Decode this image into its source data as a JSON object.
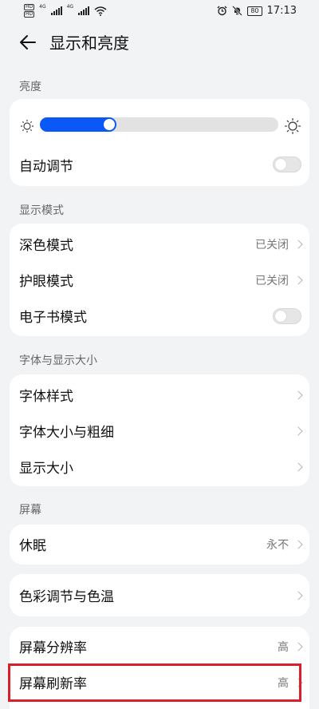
{
  "status": {
    "sim1": "HD",
    "sim2": "HD",
    "net1": "4G",
    "net2": "4G",
    "battery": "80",
    "time": "17:13"
  },
  "header": {
    "title": "显示和亮度"
  },
  "brightness": {
    "label": "亮度",
    "level": 0.32,
    "auto_label": "自动调节",
    "auto_on": false
  },
  "display_mode": {
    "label": "显示模式",
    "dark_mode": {
      "label": "深色模式",
      "value": "已关闭"
    },
    "eye_comfort": {
      "label": "护眼模式",
      "value": "已关闭"
    },
    "ebook": {
      "label": "电子书模式",
      "on": false
    }
  },
  "font": {
    "label": "字体与显示大小",
    "style": {
      "label": "字体样式"
    },
    "size_weight": {
      "label": "字体大小与粗细"
    },
    "display_size": {
      "label": "显示大小"
    }
  },
  "screen": {
    "label": "屏幕",
    "sleep": {
      "label": "休眠",
      "value": "永不"
    },
    "color": {
      "label": "色彩调节与色温"
    },
    "resolution": {
      "label": "屏幕分辨率",
      "value": "高"
    },
    "refresh_rate": {
      "label": "屏幕刷新率",
      "value": "高"
    }
  },
  "colors": {
    "accent": "#0a59f7",
    "highlight": "#d7202b"
  }
}
